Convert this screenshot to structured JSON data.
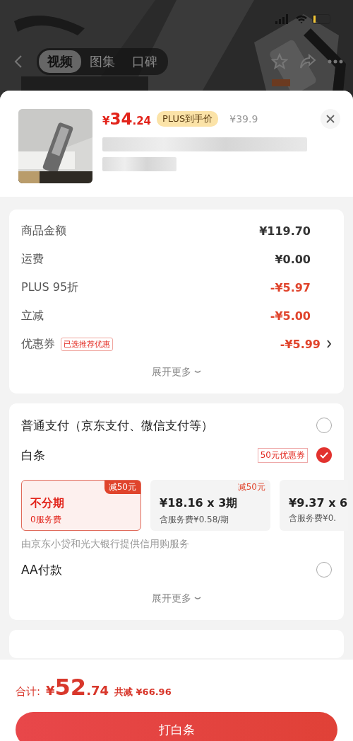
{
  "header": {
    "tabs": [
      {
        "label": "视频",
        "selected": true
      },
      {
        "label": "图集",
        "selected": false
      },
      {
        "label": "口碑",
        "selected": false
      }
    ]
  },
  "product": {
    "price_symbol": "¥",
    "price_integer": "34",
    "price_decimal": ".24",
    "price_tag": "PLUS到手价",
    "original_price": "¥39.9"
  },
  "summary": {
    "rows": [
      {
        "kind": "plain",
        "label": "商品金额",
        "value": "¥119.70"
      },
      {
        "kind": "plain",
        "label": "运费",
        "value": "¥0.00"
      },
      {
        "kind": "discount",
        "label": "PLUS 95折",
        "value": "-¥5.97"
      },
      {
        "kind": "discount",
        "label": "立减",
        "value": "-¥5.00"
      },
      {
        "kind": "discount",
        "label": "优惠券",
        "badge": "已选推荐优惠",
        "value": "-¥5.99",
        "link": true
      }
    ],
    "expand": "展开更多"
  },
  "payment": {
    "options": [
      {
        "label": "普通支付（京东支付、微信支付等）",
        "checked": false
      },
      {
        "label": "白条",
        "badge": "50元优惠券",
        "checked": true,
        "plans": [
          {
            "title": "不分期",
            "subtitle": "0服务费",
            "tag": "减50元",
            "selected": true
          },
          {
            "title": "¥18.16 x 3期",
            "subtitle": "含服务费¥0.58/期",
            "tag": "减50元",
            "selected": false
          },
          {
            "title": "¥9.37 x 6",
            "subtitle": "含服务费¥0.",
            "selected": false
          }
        ],
        "note": "由京东小贷和光大银行提供信用购服务"
      },
      {
        "label": "AA付款",
        "checked": false
      }
    ],
    "expand": "展开更多"
  },
  "footer": {
    "total_label": "合计:",
    "total_symbol": "¥",
    "total_integer": "52",
    "total_decimal": ".74",
    "saved": "共减 ¥66.96",
    "button": "打白条"
  }
}
